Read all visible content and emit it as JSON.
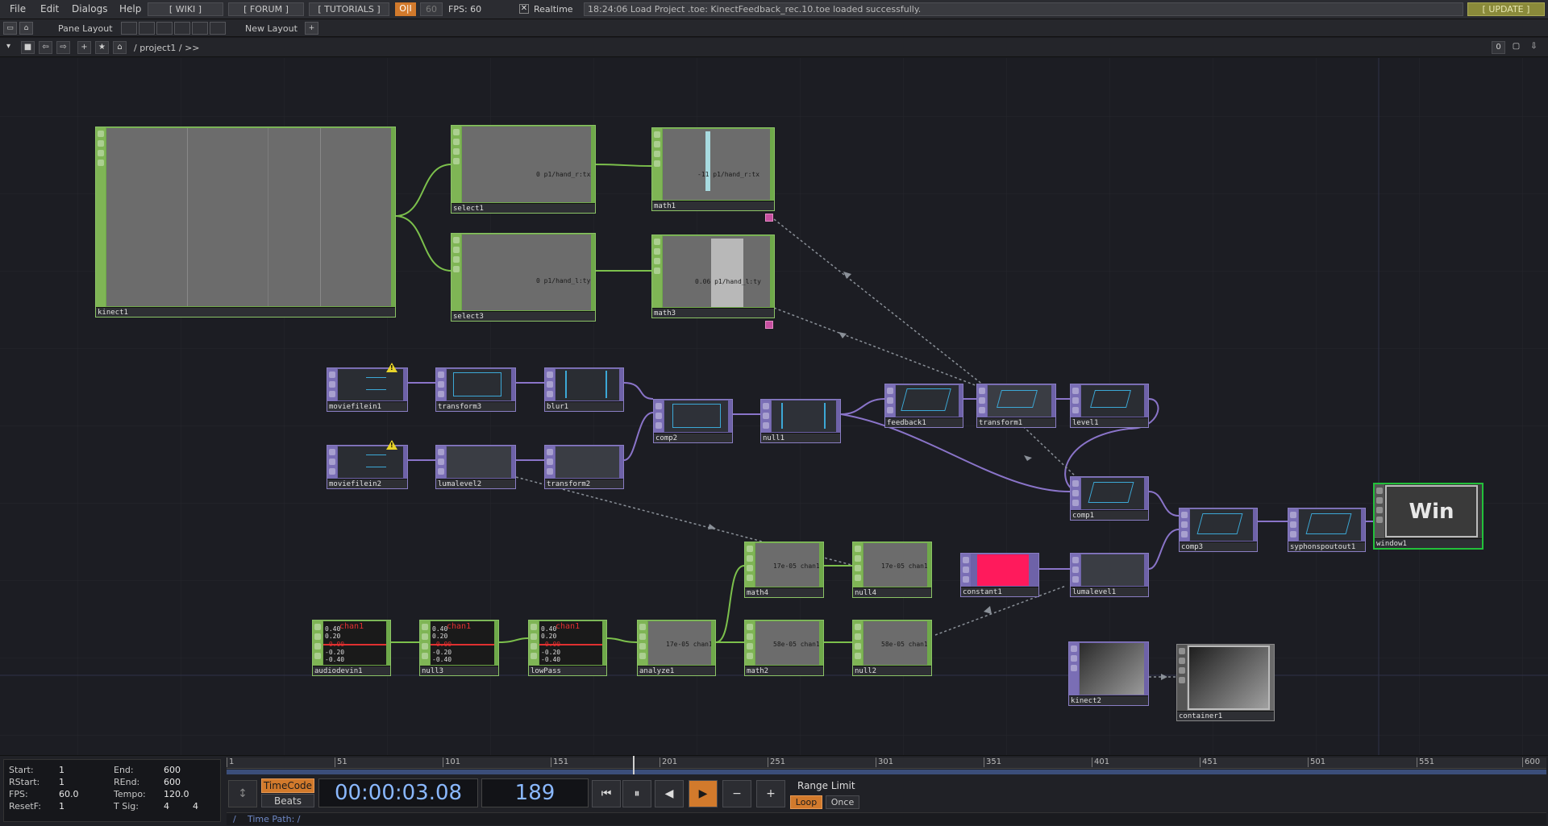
{
  "menu": {
    "file": "File",
    "edit": "Edit",
    "dialogs": "Dialogs",
    "help": "Help",
    "wiki": "[ WIKI ]",
    "forum": "[ FORUM ]",
    "tutorials": "[ TUTORIALS ]",
    "oi": "O|I",
    "fps_limit": "60",
    "fps_label": "FPS: 60",
    "realtime": "Realtime",
    "realtime_check": "✕",
    "status": "18:24:06 Load Project .toe: KinectFeedback_rec.10.toe loaded successfully.",
    "update": "[ UPDATE ]"
  },
  "toolbar": {
    "pane_layout": "Pane Layout",
    "new_layout": "New Layout",
    "plus": "+"
  },
  "pathbar": {
    "path": "/ project1 / >>",
    "right_value": "0"
  },
  "nodes": {
    "kinect1": "kinect1",
    "select1": "select1",
    "select1_val": "0 p1/hand_r:tx",
    "select3": "select3",
    "select3_val": "0 p1/hand_l:ty",
    "math1": "math1",
    "math1_val": "-11 p1/hand_r:tx",
    "math3": "math3",
    "math3_val": "0.06 p1/hand_l:ty",
    "moviefilein1": "moviefilein1",
    "transform3": "transform3",
    "blur1": "blur1",
    "moviefilein2": "moviefilein2",
    "lumalevel2": "lumalevel2",
    "transform2": "transform2",
    "comp2": "comp2",
    "null1": "null1",
    "feedback1": "feedback1",
    "transform1": "transform1",
    "level1": "level1",
    "comp1": "comp1",
    "comp3": "comp3",
    "syphonspoutout1": "syphonspoutout1",
    "window1": "window1",
    "window1_label": "Win",
    "constant1": "constant1",
    "lumalevel1": "lumalevel1",
    "math4": "math4",
    "math4_val": "17e-05 chan1",
    "null4": "null4",
    "null4_val": "17e-05 chan1",
    "audiodevin1": "audiodevin1",
    "null3": "null3",
    "lowPass": "lowPass",
    "analyze1": "analyze1",
    "analyze1_val": "17e-05 chan1",
    "math2": "math2",
    "math2_val": "58e-05 chan1",
    "null2": "null2",
    "null2_val": "58e-05 chan1",
    "kinect2": "kinect2",
    "container1": "container1",
    "audio_chan": "chan1",
    "audio_vals": [
      "0.40",
      "0.20",
      "-0.00",
      "-0.20",
      "-0.40"
    ],
    "warn_mark": "!"
  },
  "timeline": {
    "start_label": "Start:",
    "start": "1",
    "end_label": "End:",
    "end": "600",
    "rstart_label": "RStart:",
    "rstart": "1",
    "rend_label": "REnd:",
    "rend": "600",
    "fps_label": "FPS:",
    "fps": "60.0",
    "tempo_label": "Tempo:",
    "tempo": "120.0",
    "resetf_label": "ResetF:",
    "resetf": "1",
    "tsig_label": "T Sig:",
    "tsig_a": "4",
    "tsig_b": "4",
    "ticks": [
      "1",
      "51",
      "101",
      "151",
      "201",
      "251",
      "301",
      "351",
      "401",
      "451",
      "501",
      "551",
      "600"
    ],
    "timecode_label": "TimeCode",
    "beats_label": "Beats",
    "timecode": "00:00:03.08",
    "frame": "189",
    "range_limit": "Range Limit",
    "loop": "Loop",
    "once": "Once",
    "time_path": "Time Path: /",
    "time_path_slash": "/",
    "current_frame": 189,
    "range_end": 600
  },
  "colors": {
    "chop": "#6fa94a",
    "top": "#6e62a8",
    "accent": "#d27a2c",
    "window_border": "#22c03a",
    "constant_fill": "#ff1a5c"
  }
}
